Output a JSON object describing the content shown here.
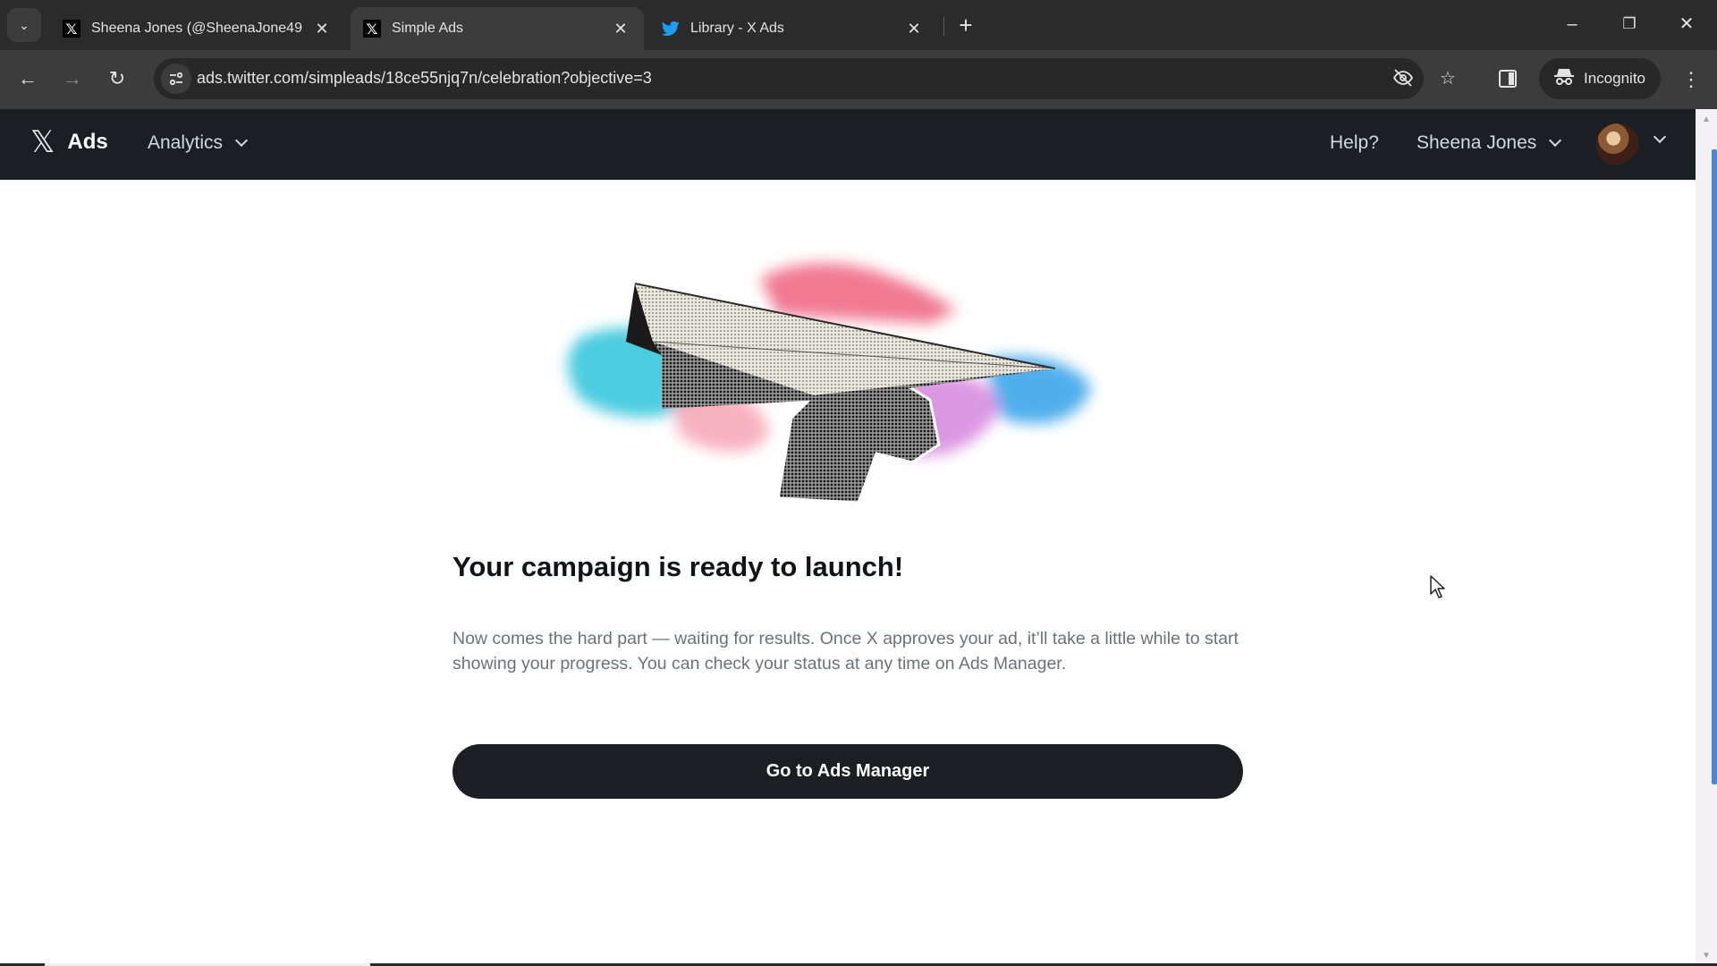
{
  "browser": {
    "tabs": [
      {
        "title": "Sheena Jones (@SheenaJone49",
        "favicon": "x-logo-icon",
        "active": false
      },
      {
        "title": "Simple Ads",
        "favicon": "x-logo-icon",
        "active": true
      },
      {
        "title": "Library - X Ads",
        "favicon": "twitter-bird-icon",
        "active": false
      }
    ],
    "tab_close_glyph": "✕",
    "new_tab_glyph": "+",
    "url": "ads.twitter.com/simpleads/18ce55njq7n/celebration?objective=3",
    "incognito_label": "Incognito",
    "window_controls": {
      "minimize": "–",
      "restore": "❐",
      "close": "✕"
    }
  },
  "appbar": {
    "brand_logo": "𝕏",
    "brand_label": "Ads",
    "nav_analytics": "Analytics",
    "help": "Help?",
    "account_name": "Sheena Jones"
  },
  "main": {
    "illustration_alt": "Hand launching a paper airplane over colorful brush strokes",
    "headline": "Your campaign is ready to launch!",
    "body": "Now comes the hard part — waiting for results. Once X approves your ad, it’ll take a little while to start showing your progress. You can check your status at any time on Ads Manager.",
    "cta_label": "Go to Ads Manager"
  },
  "colors": {
    "appbar_bg": "#1b1f23",
    "cta_bg": "#1b1f23",
    "headline": "#0f1419",
    "body_text": "#6b7278",
    "scroll_thumb": "#4a86d4"
  }
}
